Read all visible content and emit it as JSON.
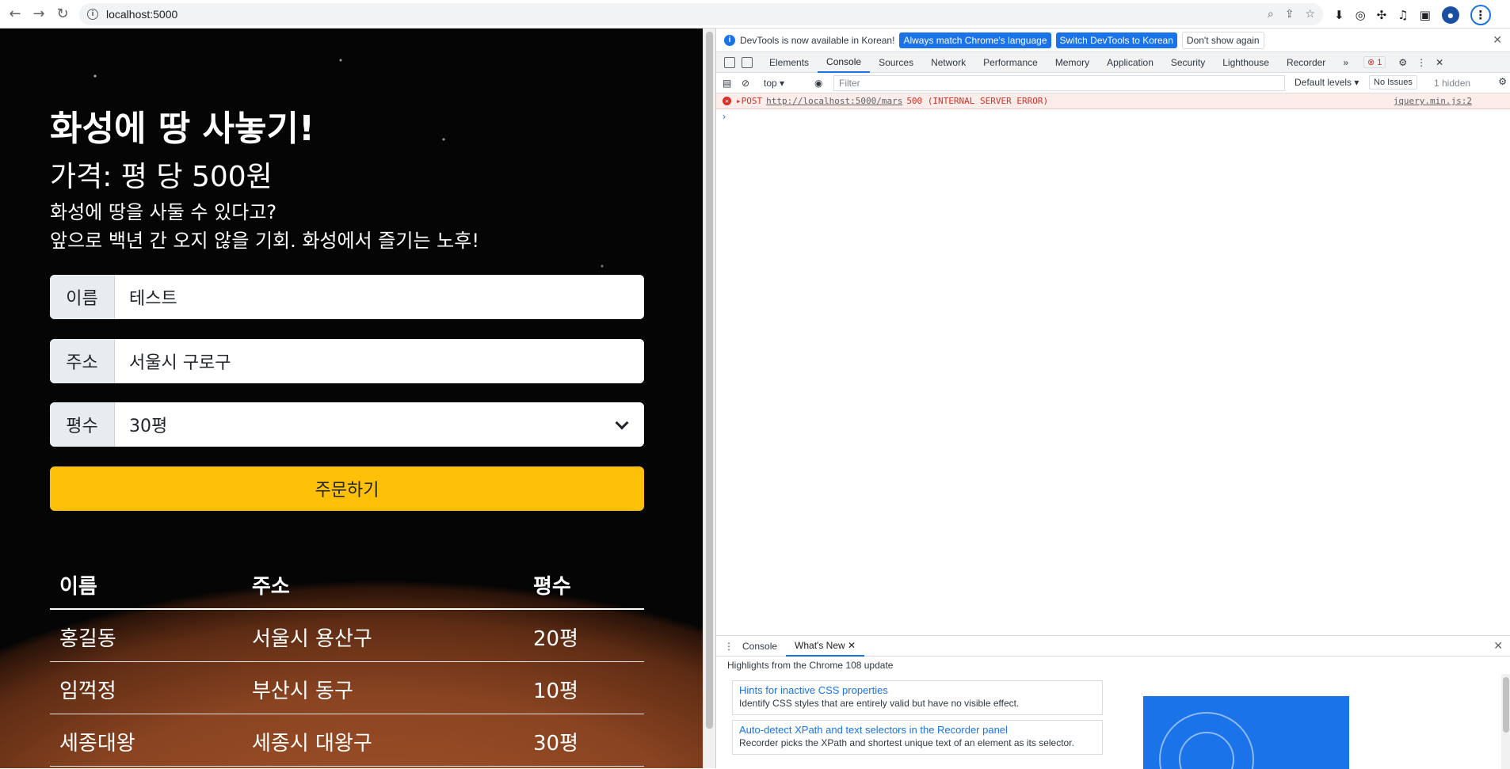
{
  "browser": {
    "url": "localhost:5000"
  },
  "page": {
    "title": "화성에 땅 사놓기!",
    "price": "가격: 평 당 500원",
    "desc_line1": "화성에 땅을 사둘 수 있다고?",
    "desc_line2": "앞으로 백년 간 오지 않을 기회. 화성에서 즐기는 노후!",
    "form": {
      "name_label": "이름",
      "name_value": "테스트",
      "address_label": "주소",
      "address_value": "서울시 구로구",
      "size_label": "평수",
      "size_value": "30평"
    },
    "order_button": "주문하기",
    "table": {
      "headers": [
        "이름",
        "주소",
        "평수"
      ],
      "rows": [
        [
          "홍길동",
          "서울시 용산구",
          "20평"
        ],
        [
          "임꺽정",
          "부산시 동구",
          "10평"
        ],
        [
          "세종대왕",
          "세종시 대왕구",
          "30평"
        ]
      ]
    }
  },
  "devtools": {
    "infobar": {
      "message": "DevTools is now available in Korean!",
      "btn_match": "Always match Chrome's language",
      "btn_switch": "Switch DevTools to Korean",
      "btn_dont": "Don't show again"
    },
    "tabs": [
      "Elements",
      "Console",
      "Sources",
      "Network",
      "Performance",
      "Memory",
      "Application",
      "Security",
      "Lighthouse",
      "Recorder"
    ],
    "error_count": "1",
    "console": {
      "context": "top",
      "filter_placeholder": "Filter",
      "levels": "Default levels",
      "issues": "No Issues",
      "hidden": "1 hidden",
      "error_method": "POST",
      "error_url": "http://localhost:5000/mars",
      "error_status": "500 (INTERNAL SERVER ERROR)",
      "error_source": "jquery.min.js:2"
    },
    "drawer": {
      "tab_console": "Console",
      "tab_whatsnew": "What's New",
      "highlights": "Highlights from the Chrome 108 update",
      "card1_title": "Hints for inactive CSS properties",
      "card1_desc": "Identify CSS styles that are entirely valid but have no visible effect.",
      "card2_title": "Auto-detect XPath and text selectors in the Recorder panel",
      "card2_desc": "Recorder picks the XPath and shortest unique text of an element as its selector."
    }
  },
  "colors": {
    "accent": "#ffc107",
    "link": "#1a73e8",
    "error": "#d93025"
  }
}
